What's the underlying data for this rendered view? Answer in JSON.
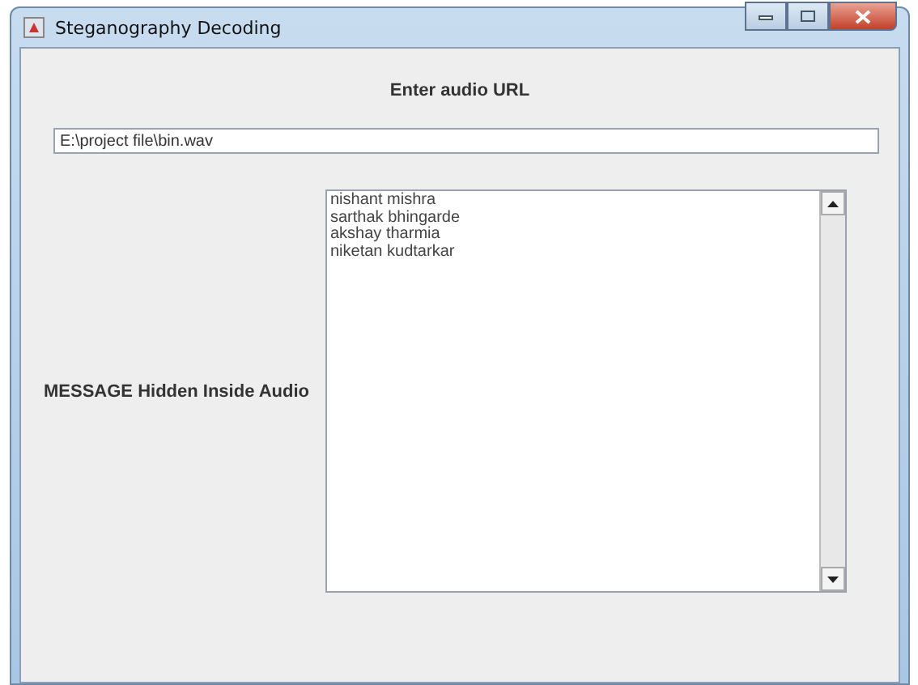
{
  "window": {
    "title": "Steganography Decoding"
  },
  "url_label": "Enter audio URL",
  "url_field": {
    "value": "E:\\project file\\bin.wav"
  },
  "message_label": "MESSAGE Hidden Inside Audio",
  "message_lines": [
    "nishant mishra",
    "sarthak bhingarde",
    "akshay tharmia",
    "niketan kudtarkar"
  ]
}
